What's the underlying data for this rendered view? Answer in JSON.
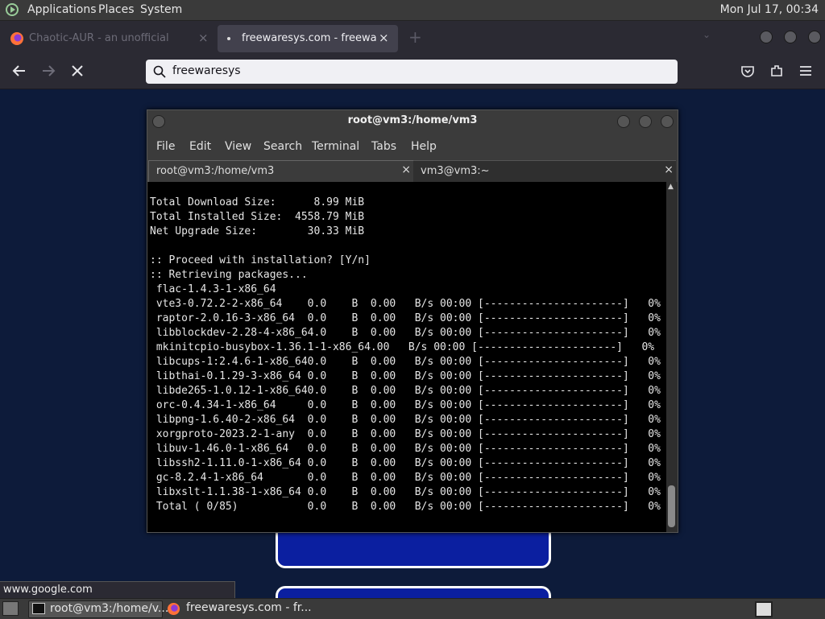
{
  "top_panel": {
    "menus": [
      "Applications",
      "Places",
      "System"
    ],
    "clock": "Mon Jul 17, 00:34"
  },
  "browser": {
    "tabs": [
      {
        "title": "Chaotic-AUR - an unofficial",
        "close": "×"
      },
      {
        "title": "freewaresys.com - freeware",
        "close": "×"
      }
    ],
    "new_tab": "+",
    "url": "freewaresys",
    "status_url": "www.google.com"
  },
  "terminal": {
    "title": "root@vm3:/home/vm3",
    "menus": [
      "File",
      "Edit",
      "View",
      "Search",
      "Terminal",
      "Tabs",
      "Help"
    ],
    "tabs": [
      {
        "label": "root@vm3:/home/vm3",
        "close": "×"
      },
      {
        "label": "vm3@vm3:~",
        "close": "×"
      }
    ],
    "lines": [
      "Total Download Size:      8.99 MiB",
      "Total Installed Size:  4558.79 MiB",
      "Net Upgrade Size:        30.33 MiB",
      "",
      ":: Proceed with installation? [Y/n]",
      ":: Retrieving packages...",
      " flac-1.4.3-1-x86_64",
      " vte3-0.72.2-2-x86_64    0.0    B  0.00   B/s 00:00 [----------------------]   0%",
      " raptor-2.0.16-3-x86_64  0.0    B  0.00   B/s 00:00 [----------------------]   0%",
      " libblockdev-2.28-4-x86_64.0    B  0.00   B/s 00:00 [----------------------]   0%",
      " mkinitcpio-busybox-1.36.1-1-x86_64.00   B/s 00:00 [----------------------]   0%",
      " libcups-1:2.4.6-1-x86_640.0    B  0.00   B/s 00:00 [----------------------]   0%",
      " libthai-0.1.29-3-x86_64 0.0    B  0.00   B/s 00:00 [----------------------]   0%",
      " libde265-1.0.12-1-x86_640.0    B  0.00   B/s 00:00 [----------------------]   0%",
      " orc-0.4.34-1-x86_64     0.0    B  0.00   B/s 00:00 [----------------------]   0%",
      " libpng-1.6.40-2-x86_64  0.0    B  0.00   B/s 00:00 [----------------------]   0%",
      " xorgproto-2023.2-1-any  0.0    B  0.00   B/s 00:00 [----------------------]   0%",
      " libuv-1.46.0-1-x86_64   0.0    B  0.00   B/s 00:00 [----------------------]   0%",
      " libssh2-1.11.0-1-x86_64 0.0    B  0.00   B/s 00:00 [----------------------]   0%",
      " gc-8.2.4-1-x86_64       0.0    B  0.00   B/s 00:00 [----------------------]   0%",
      " libxslt-1.1.38-1-x86_64 0.0    B  0.00   B/s 00:00 [----------------------]   0%",
      " Total ( 0/85)           0.0    B  0.00   B/s 00:00 [----------------------]   0%"
    ]
  },
  "taskbar": {
    "items": [
      "root@vm3:/home/v...",
      "freewaresys.com - fr..."
    ]
  }
}
